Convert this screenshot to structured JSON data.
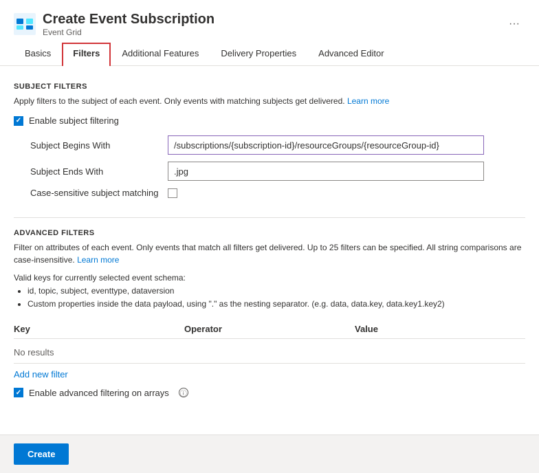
{
  "header": {
    "icon_alt": "event-grid-icon",
    "title": "Create Event Subscription",
    "subtitle": "Event Grid",
    "ellipsis": "···"
  },
  "tabs": [
    {
      "id": "basics",
      "label": "Basics",
      "active": false
    },
    {
      "id": "filters",
      "label": "Filters",
      "active": true
    },
    {
      "id": "additional-features",
      "label": "Additional Features",
      "active": false
    },
    {
      "id": "delivery-properties",
      "label": "Delivery Properties",
      "active": false
    },
    {
      "id": "advanced-editor",
      "label": "Advanced Editor",
      "active": false
    }
  ],
  "subject_filters": {
    "section_title": "SUBJECT FILTERS",
    "description": "Apply filters to the subject of each event. Only events with matching subjects get delivered.",
    "learn_more": "Learn more",
    "enable_label": "Enable subject filtering",
    "enable_checked": true,
    "subject_begins_with_label": "Subject Begins With",
    "subject_begins_with_value": "/subscriptions/{subscription-id}/resourceGroups/{resourceGroup-id}",
    "subject_ends_with_label": "Subject Ends With",
    "subject_ends_with_value": ".jpg",
    "case_sensitive_label": "Case-sensitive subject matching",
    "case_sensitive_checked": false
  },
  "advanced_filters": {
    "section_title": "ADVANCED FILTERS",
    "description": "Filter on attributes of each event. Only events that match all filters get delivered. Up to 25 filters can be specified. All string comparisons are case-insensitive.",
    "learn_more": "Learn more",
    "valid_keys_title": "Valid keys for currently selected event schema:",
    "valid_keys_items": [
      "id, topic, subject, eventtype, dataversion",
      "Custom properties inside the data payload, using \".\" as the nesting separator. (e.g. data, data.key, data.key1.key2)"
    ],
    "table_headers": [
      "Key",
      "Operator",
      "Value"
    ],
    "no_results": "No results",
    "add_filter_label": "Add new filter",
    "enable_advanced_label": "Enable advanced filtering on arrays",
    "enable_advanced_checked": true,
    "tooltip_icon": "ⓘ"
  },
  "footer": {
    "create_label": "Create"
  }
}
